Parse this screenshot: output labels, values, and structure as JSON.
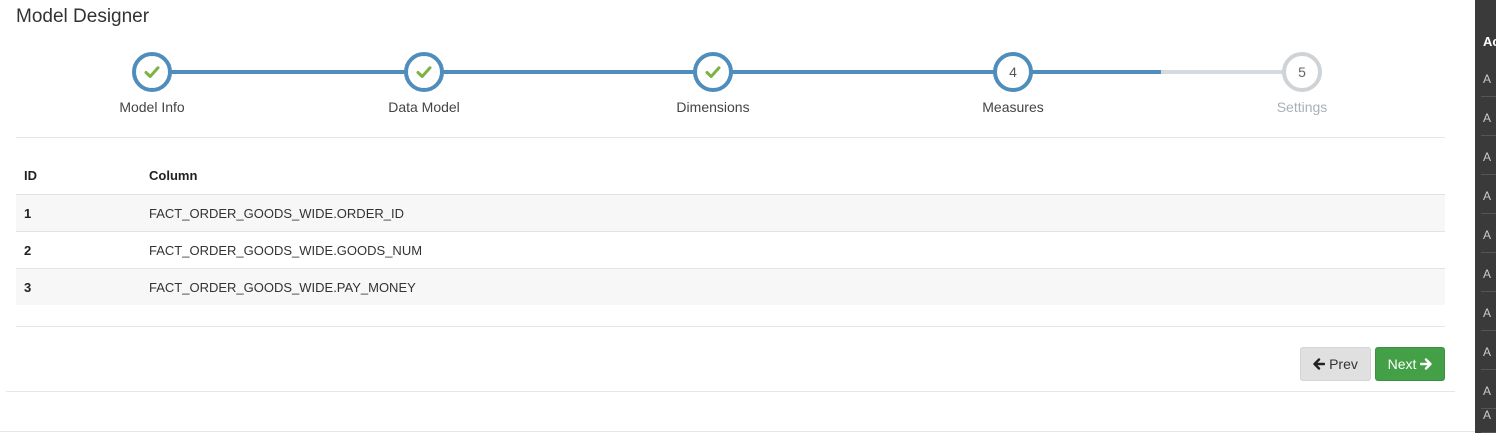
{
  "page": {
    "title": "Model Designer"
  },
  "wizard": {
    "steps": [
      {
        "label": "Model Info",
        "status": "done",
        "marker": "check-icon"
      },
      {
        "label": "Data Model",
        "status": "done",
        "marker": "check-icon"
      },
      {
        "label": "Dimensions",
        "status": "done",
        "marker": "check-icon"
      },
      {
        "label": "Measures",
        "status": "active",
        "number": "4"
      },
      {
        "label": "Settings",
        "status": "pending",
        "number": "5"
      }
    ]
  },
  "table": {
    "headers": [
      "ID",
      "Column"
    ],
    "rows": [
      {
        "id": "1",
        "column": "FACT_ORDER_GOODS_WIDE.ORDER_ID"
      },
      {
        "id": "2",
        "column": "FACT_ORDER_GOODS_WIDE.GOODS_NUM"
      },
      {
        "id": "3",
        "column": "FACT_ORDER_GOODS_WIDE.PAY_MONEY"
      }
    ]
  },
  "buttons": {
    "prev": "Prev",
    "next": "Next"
  },
  "side_panel": {
    "header": "Ac",
    "rows": [
      "A",
      "A",
      "A",
      "A",
      "A",
      "A",
      "A",
      "A",
      "A",
      "A"
    ]
  },
  "colors": {
    "accent": "#4f8dbd",
    "success": "#43a047",
    "check": "#7cb342",
    "pending": "#d0d3d6"
  }
}
